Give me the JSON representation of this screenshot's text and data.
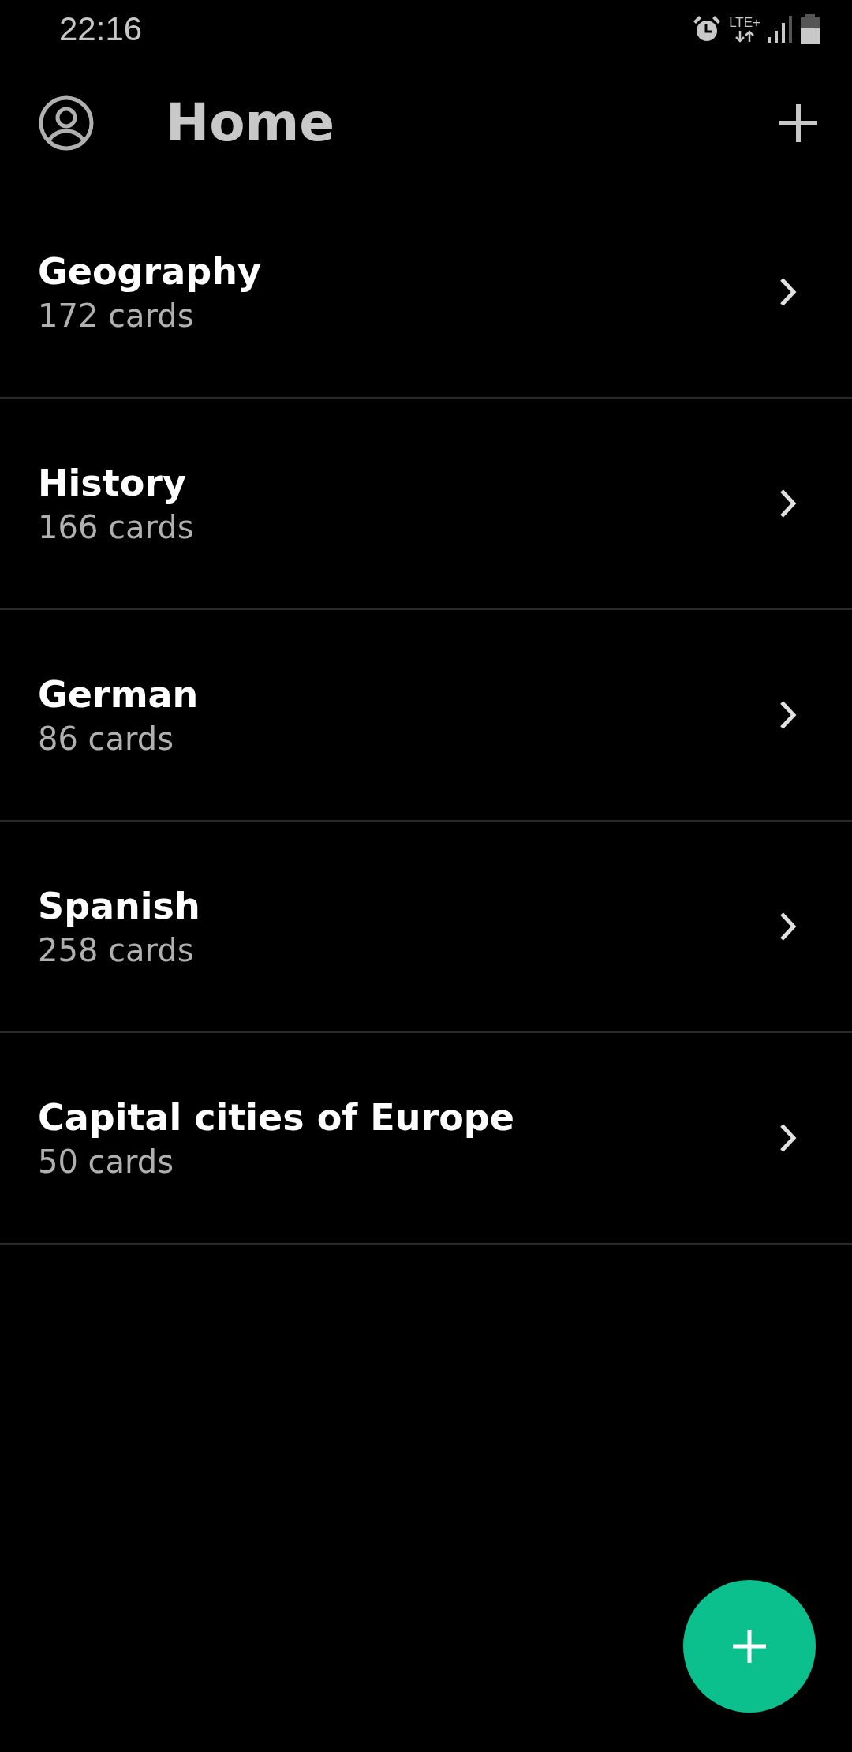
{
  "status_bar": {
    "time": "22:16",
    "network": "LTE+"
  },
  "header": {
    "title": "Home"
  },
  "decks": [
    {
      "name": "Geography",
      "count": "172 cards"
    },
    {
      "name": "History",
      "count": "166 cards"
    },
    {
      "name": "German",
      "count": "86 cards"
    },
    {
      "name": "Spanish",
      "count": "258 cards"
    },
    {
      "name": "Capital cities of Europe",
      "count": "50 cards"
    }
  ]
}
